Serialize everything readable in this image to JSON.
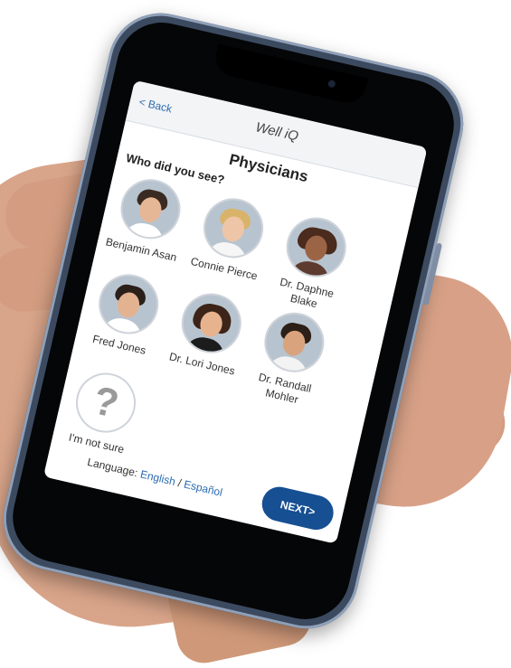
{
  "header": {
    "back_label": "< Back",
    "brand": "Well iQ"
  },
  "page": {
    "title": "Physicians",
    "question": "Who did you see?"
  },
  "physicians": [
    {
      "name": "Benjamin Asan"
    },
    {
      "name": "Connie Pierce"
    },
    {
      "name": "Dr. Daphne Blake"
    },
    {
      "name": "Fred Jones"
    },
    {
      "name": "Dr. Lori Jones"
    },
    {
      "name": "Dr. Randall Mohler"
    }
  ],
  "unsure": {
    "icon": "question-mark-icon",
    "label": "I'm not sure"
  },
  "footer": {
    "language_label": "Language:",
    "english": "English",
    "separator": "/",
    "spanish": "Español"
  },
  "next_button": {
    "label": "NEXT>"
  },
  "colors": {
    "accent": "#164f92",
    "link": "#2b6bb0"
  }
}
